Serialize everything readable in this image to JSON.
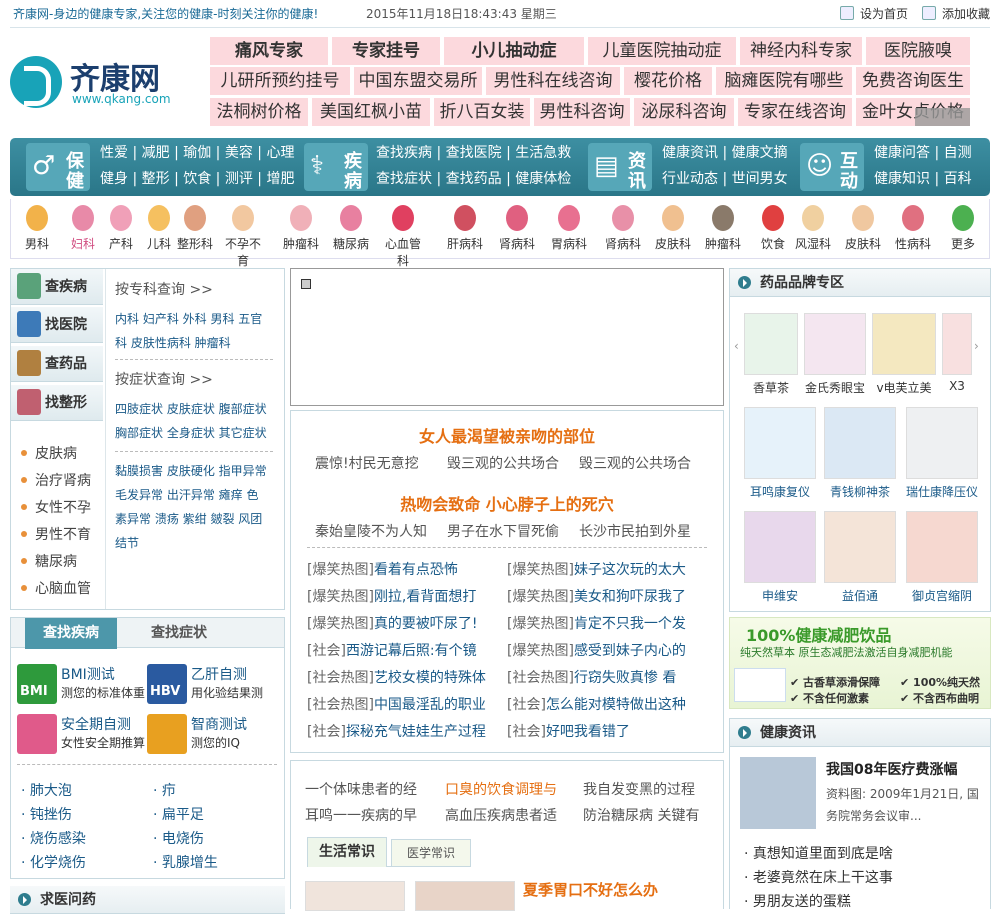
{
  "topbar": {
    "slogan": "齐康网-身边的健康专家,关注您的健康-时刻关注你的健康!",
    "datetime": "2015年11月18日18:43:43 星期三",
    "set_home": "设为首页",
    "add_fav": "添加收藏"
  },
  "logo": {
    "name": "齐康网",
    "url": "www.qkang.com"
  },
  "keywords": {
    "row1": [
      "痛风专家",
      "专家挂号",
      "小儿抽动症",
      "儿童医院抽动症",
      "神经内科专家",
      "医院腋嗅"
    ],
    "row2": [
      "儿研所预约挂号",
      "中国东盟交易所",
      "男性科在线咨询",
      "樱花价格",
      "脑瘫医院有哪些",
      "免费咨询医生"
    ],
    "row3": [
      "法桐树价格",
      "美国红枫小苗",
      "折八百女装",
      "男性科咨询",
      "泌尿科咨询",
      "专家在线咨询",
      "金叶女贞价格"
    ]
  },
  "nav": {
    "sections": [
      {
        "t1": "保",
        "t2": "健",
        "links1": "性爱 | 减肥 | 瑜伽 | 美容 | 心理",
        "links2": "健身 | 整形 | 饮食 | 测评 | 增肥"
      },
      {
        "t1": "疾",
        "t2": "病",
        "links1": "查找疾病 | 查找医院 | 生活急救",
        "links2": "查找症状 | 查找药品 | 健康体检"
      },
      {
        "t1": "资",
        "t2": "讯",
        "links1": "健康资讯 | 健康文摘",
        "links2": "行业动态 | 世间男女"
      },
      {
        "t1": "互",
        "t2": "动",
        "links1": "健康问答 | 自测",
        "links2": "健康知识 | 百科"
      }
    ]
  },
  "categories": [
    "男科",
    "妇科",
    "产科",
    "儿科",
    "整形科",
    "不孕不育",
    "肿瘤科",
    "糖尿病",
    "心血管科",
    "肝病科",
    "肾病科",
    "胃病科",
    "肾病科",
    "皮肤科",
    "肿瘤科",
    "饮食",
    "风湿科",
    "皮肤科",
    "性病科",
    "更多"
  ],
  "category_colors": [
    "#f2b24a",
    "#e88aa8",
    "#f0a0b8",
    "#f5c060",
    "#e0a080",
    "#f2c8a0",
    "#f0b0b8",
    "#e880a0",
    "#e04060",
    "#d05060",
    "#e06080",
    "#e87090",
    "#e890a8",
    "#f0c090",
    "#8a7a6a",
    "#e04040",
    "#f0d0a0",
    "#f0c8a0",
    "#e07080",
    "#4cb050"
  ],
  "left": {
    "tabs": [
      "查疾病",
      "找医院",
      "查药品",
      "找整形"
    ],
    "by_dept_title": "按专科查询 >>",
    "by_dept_line1": "内科  妇产科  外科  男科  五官",
    "by_dept_line2": "科  皮肤性病科  肿瘤科",
    "by_symptom_title": "按症状查询 >>",
    "by_symptom_line1": "四肢症状  皮肤症状  腹部症状",
    "by_symptom_line2": "胸部症状  全身症状  其它症状",
    "symptom_lines": [
      "黏膜损害  皮肤硬化  指甲异常",
      "毛发异常  出汗异常  瘫痒  色",
      "素异常  溃疡  紫绀  皴裂  风团",
      "结节"
    ],
    "diseases": [
      "皮肤病",
      "治疗肾病",
      "女性不孕",
      "男性不育",
      "糖尿病",
      "心脑血管"
    ],
    "search_tabs": [
      "查找疾病",
      "查找症状"
    ],
    "tools": [
      {
        "title": "BMI测试",
        "desc": "测您的标准体重",
        "color": "#2e9a3c",
        "badge": "BMI"
      },
      {
        "title": "乙肝自测",
        "desc": "用化验结果测",
        "color": "#2a5aa0",
        "badge": "HBV"
      },
      {
        "title": "安全期自测",
        "desc": "女性安全期推算",
        "color": "#e05a8a",
        "badge": ""
      },
      {
        "title": "智商测试",
        "desc": "测您的IQ",
        "color": "#e8a020",
        "badge": ""
      }
    ],
    "bullets_left": [
      "肺大泡",
      "钝挫伤",
      "烧伤感染",
      "化学烧伤"
    ],
    "bullets_right": [
      "疖",
      "扁平足",
      "电烧伤",
      "乳腺增生"
    ],
    "ask_title": "求医问药"
  },
  "center": {
    "headline1": "女人最渴望被亲吻的部位",
    "sub1": [
      "震惊!村民无意挖",
      "毁三观的公共场合",
      "毁三观的公共场合"
    ],
    "headline2": "热吻会致命 小心脖子上的死穴",
    "sub2": [
      "秦始皇陵不为人知",
      "男子在水下冒死偷",
      "长沙市民拍到外星"
    ],
    "news": [
      {
        "tag": "[爆笑热图]",
        "text": "看着有点恐怖"
      },
      {
        "tag": "[爆笑热图]",
        "text": "妹子这次玩的太大"
      },
      {
        "tag": "[爆笑热图]",
        "text": "刚拉,看背面想打"
      },
      {
        "tag": "[爆笑热图]",
        "text": "美女和狗吓尿我了"
      },
      {
        "tag": "[爆笑热图]",
        "text": "真的要被吓尿了!"
      },
      {
        "tag": "[爆笑热图]",
        "text": "肯定不只我一个发"
      },
      {
        "tag": "[社会]",
        "text": "西游记幕后照:有个镜"
      },
      {
        "tag": "[爆笑热图]",
        "text": "感受到妹子内心的"
      },
      {
        "tag": "[社会热图]",
        "text": "艺校女模的特殊体"
      },
      {
        "tag": "[社会热图]",
        "text": "行窃失败真惨 看"
      },
      {
        "tag": "[社会热图]",
        "text": "中国最淫乱的职业"
      },
      {
        "tag": "[社会]",
        "text": "怎么能对模特做出这种"
      },
      {
        "tag": "[社会]",
        "text": "探秘充气娃娃生产过程"
      },
      {
        "tag": "[社会]",
        "text": "好吧我看错了"
      }
    ],
    "more_row1": [
      "一个体味患者的经",
      "口臭的饮食调理与",
      "我自发变黑的过程"
    ],
    "more_row2": [
      "耳鸣一一疾病的早",
      "高血压疾病患者适",
      "防治糖尿病 关键有"
    ],
    "life_tabs": [
      "生活常识",
      "医学常识"
    ],
    "life_headline": "夏季胃口不好怎么办"
  },
  "right": {
    "brand_title": "药品品牌专区",
    "brand_row": [
      "香草茶",
      "金氏秀眼宝",
      "v电芙立美",
      "X3"
    ],
    "products_row1": [
      "耳鸣康复仪",
      "青钱柳神茶",
      "瑞仕康降压仪"
    ],
    "products_row2": [
      "申维安",
      "益佰通",
      "御贞宫缩阴"
    ],
    "ad_headline": "100%健康减肥饮品",
    "ad_sub": "纯天然草本  原生态减肥法激活自身减肥机能",
    "ad_points": [
      "古香草添滑保障",
      "100%纯天然",
      "不含任何激素",
      "不含西布曲明"
    ],
    "health_title": "健康资讯",
    "feature_title": "我国08年医疗费涨幅",
    "feature_desc": "资料图: 2009年1月21日, 国务院常务会议审...",
    "list": [
      "真想知道里面到底是啥",
      "老婆竟然在床上干这事",
      "男朋友送的蛋糕"
    ]
  }
}
